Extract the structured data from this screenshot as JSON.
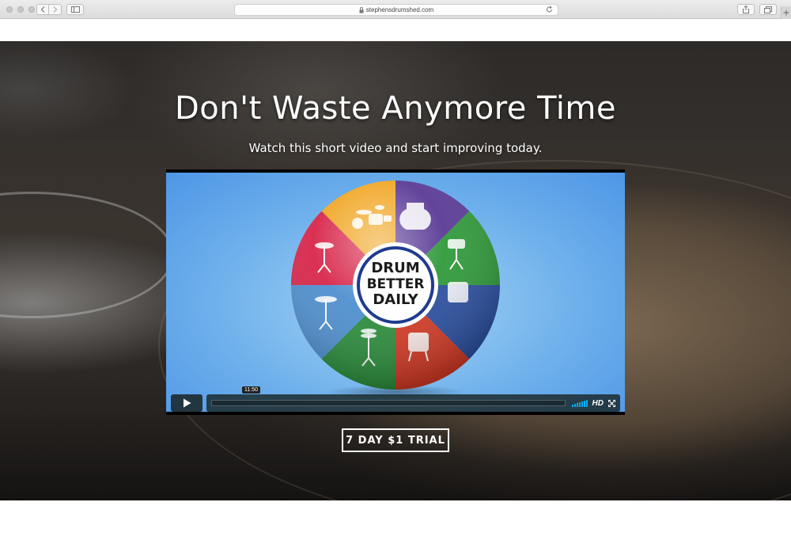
{
  "browser": {
    "url": "stephensdrumshed.com"
  },
  "hero": {
    "headline": "Don't Waste Anymore Time",
    "subline": "Watch this short video and start improving today."
  },
  "video": {
    "logo_lines": [
      "DRUM",
      "BETTER",
      "DAILY"
    ],
    "duration": "11:50",
    "quality": "HD",
    "progress": 0.0,
    "segment_colors": [
      "#5a3a96",
      "#2f9a3a",
      "#2a4fa0",
      "#d33a25",
      "#2c8d3c",
      "#4f8fcf",
      "#d8264a",
      "#f0a623"
    ]
  },
  "cta": {
    "label": "7 DAY $1 TRIAL"
  },
  "colors": {
    "accent": "#00adef"
  }
}
